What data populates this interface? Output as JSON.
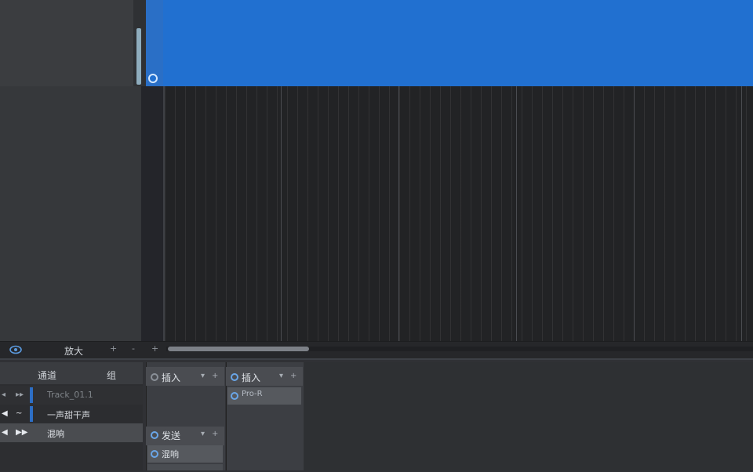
{
  "zoom_strip": {
    "zoom_label": "放大",
    "btn_plus": "+",
    "btn_minus": "-",
    "btn_fit": "+"
  },
  "mixer": {
    "header_left": "通道",
    "header_right": "组",
    "rows": [
      {
        "ctrl1": "◂",
        "ctrl2": "▸▸",
        "label": "Track_01.1"
      },
      {
        "ctrl1": "◀",
        "ctrl2": "~",
        "label": "一声甜干声"
      },
      {
        "ctrl1": "◀",
        "ctrl2": "▶▶",
        "label": "混响"
      }
    ]
  },
  "inserts": {
    "col1": {
      "title": "插入",
      "send_title": "发送",
      "send_item": "混响"
    },
    "col2": {
      "title": "插入",
      "plugin": "Pro-R"
    },
    "ctrl_down": "▾",
    "ctrl_plus": "+"
  },
  "colors": {
    "accent": "#2170d0",
    "bg": "#2a2b2d"
  }
}
